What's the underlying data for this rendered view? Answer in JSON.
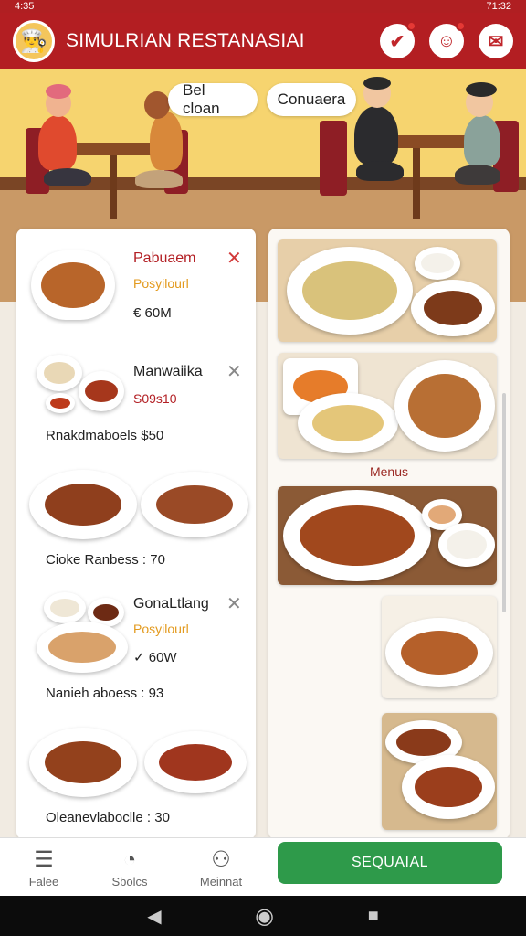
{
  "status": {
    "time_left": "4:35",
    "time_right": "71:32"
  },
  "app": {
    "title": "SIMULRIAN RESTANASIAI",
    "accent": "#b31e22"
  },
  "header_icons": [
    "check-bubble-icon",
    "face-bubble-icon",
    "chat-bubble-icon"
  ],
  "banner": {
    "pill_left": "Bel cloan",
    "pill_right": "Conuaera"
  },
  "left_items": [
    {
      "name": "Pabuaem",
      "sub": "Posyilourl",
      "price": "€ 60M",
      "caption": ""
    },
    {
      "name": "Manwaiika",
      "sub": "S09s10",
      "price": "",
      "caption": "Rnakdmaboels $50"
    },
    {
      "name": "",
      "sub": "",
      "price": "",
      "caption": "Cioke Ranbess : 70"
    },
    {
      "name": "GonaLtlang",
      "sub": "Posyilourl",
      "price": "✓ 60W",
      "caption": "Nanieh aboess : 93"
    },
    {
      "name": "",
      "sub": "",
      "price": "",
      "caption": "Oleanevlaboclle : 30"
    }
  ],
  "right_panel": {
    "menu_label": "Menus"
  },
  "bottom_nav": {
    "items": [
      {
        "label": "Falee",
        "icon": "menu-list-icon"
      },
      {
        "label": "Sbolcs",
        "icon": "clock-icon"
      },
      {
        "label": "Meinnat",
        "icon": "user-icon"
      }
    ],
    "cta_label": "SEQUAIAL",
    "cta_color": "#2e9a4a"
  }
}
